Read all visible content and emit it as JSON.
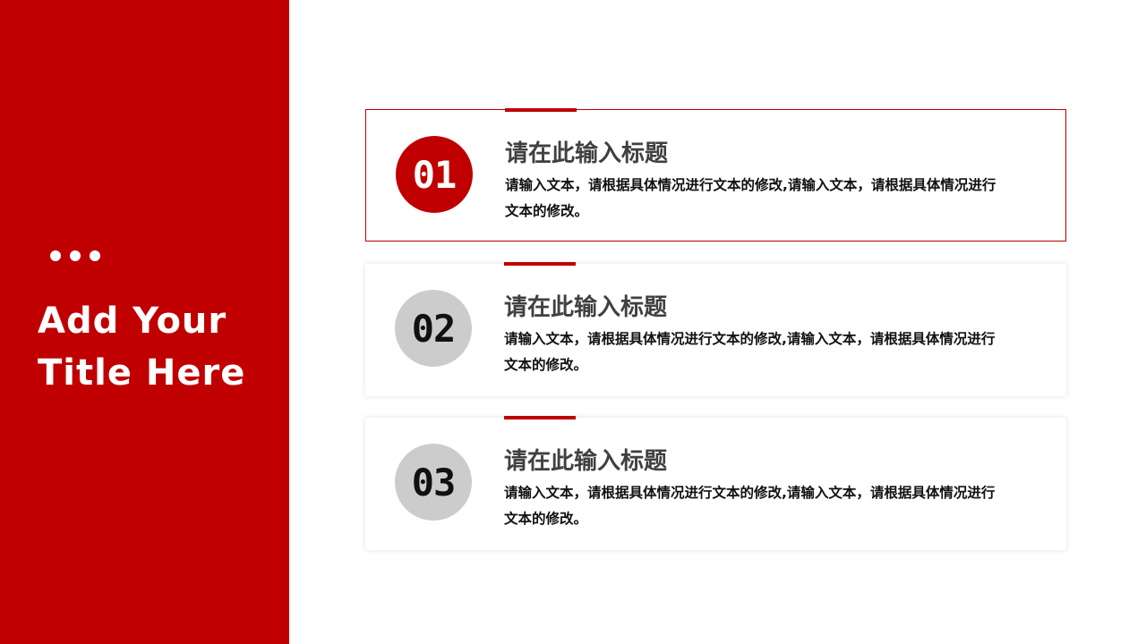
{
  "sidebar": {
    "title_line1": "Add Your",
    "title_line2": "Title Here"
  },
  "colors": {
    "accent": "#c00000",
    "inactive_circle": "#cccccc"
  },
  "items": [
    {
      "number": "01",
      "title": "请在此输入标题",
      "text": "请输入文本，请根据具体情况进行文本的修改,请输入文本，请根据具体情况进行文本的修改。",
      "active": true
    },
    {
      "number": "02",
      "title": "请在此输入标题",
      "text": "请输入文本，请根据具体情况进行文本的修改,请输入文本，请根据具体情况进行文本的修改。",
      "active": false
    },
    {
      "number": "03",
      "title": "请在此输入标题",
      "text": "请输入文本，请根据具体情况进行文本的修改,请输入文本，请根据具体情况进行文本的修改。",
      "active": false
    }
  ]
}
